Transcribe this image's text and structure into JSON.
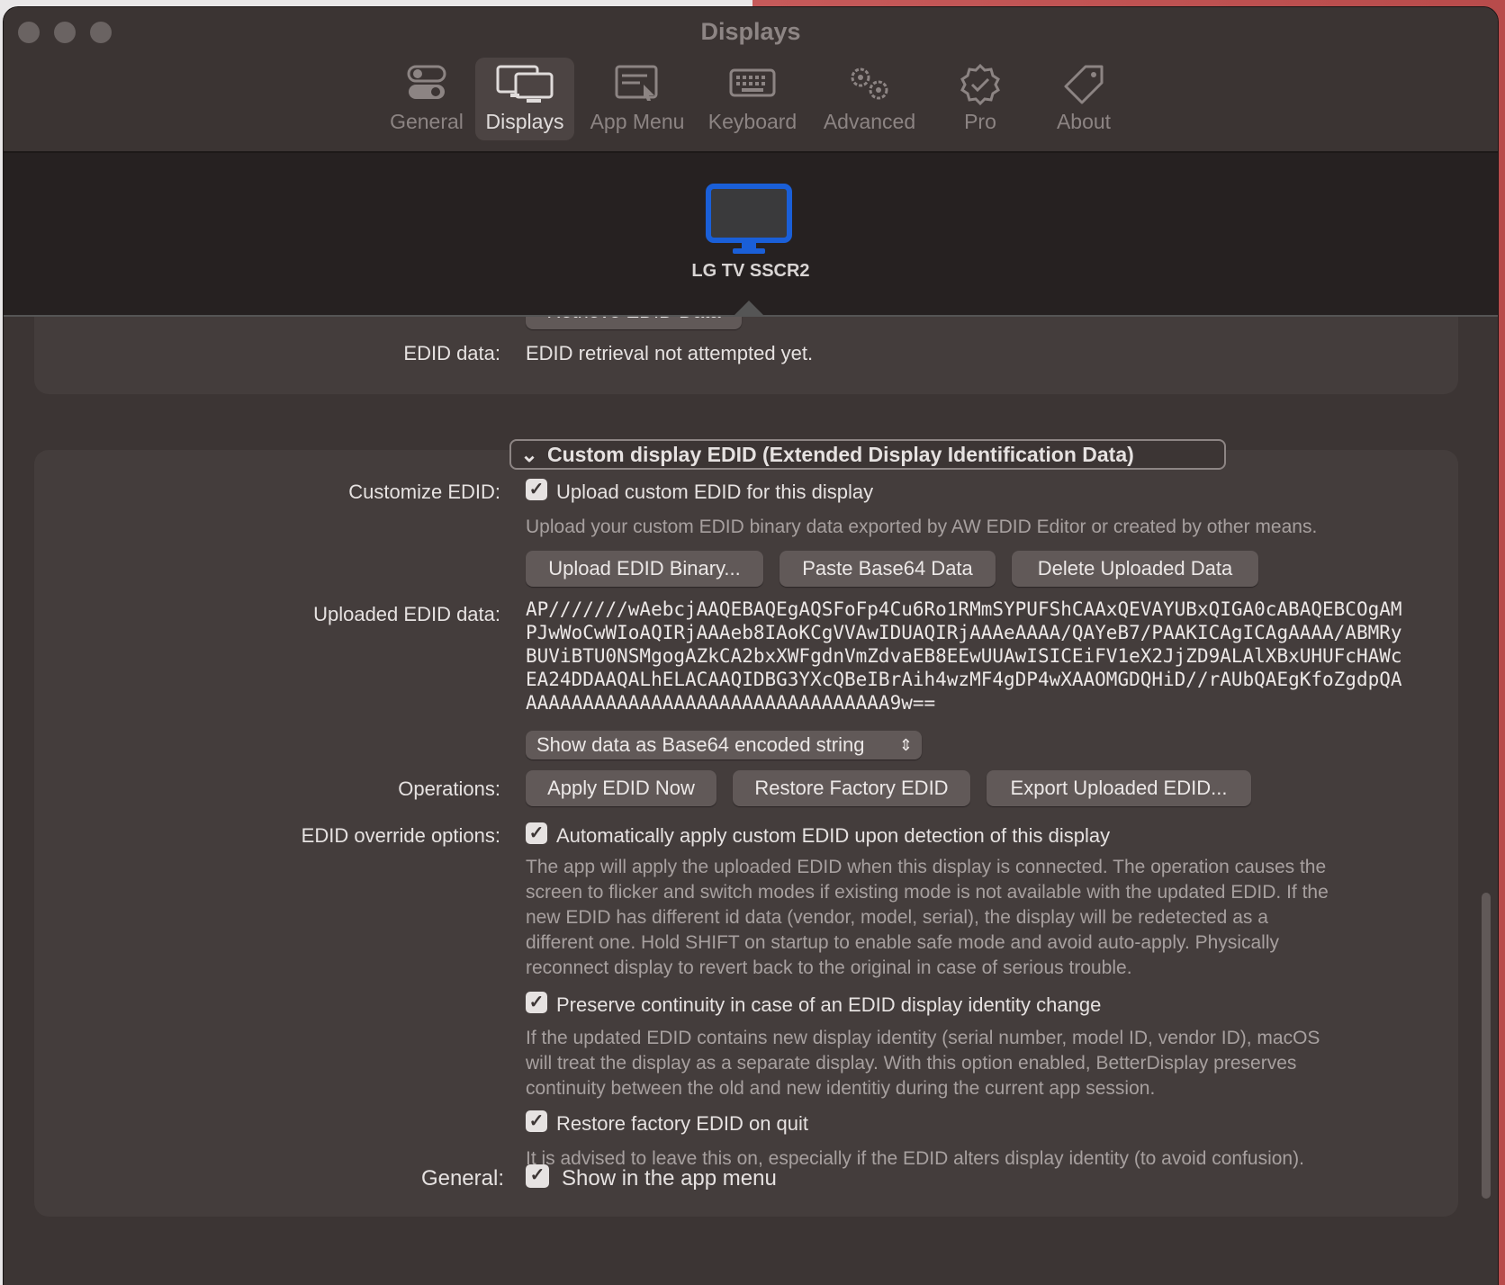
{
  "window": {
    "title": "Displays"
  },
  "toolbar": [
    {
      "label": "General",
      "icon": "toggle-icon"
    },
    {
      "label": "Displays",
      "icon": "displays-icon"
    },
    {
      "label": "App Menu",
      "icon": "app-menu-icon"
    },
    {
      "label": "Keyboard",
      "icon": "keyboard-icon"
    },
    {
      "label": "Advanced",
      "icon": "gears-icon"
    },
    {
      "label": "Pro",
      "icon": "seal-check-icon"
    },
    {
      "label": "About",
      "icon": "tag-icon"
    }
  ],
  "display": {
    "name": "LG TV SSCR2",
    "icon": "monitor-icon",
    "accent": "#1a5fd8"
  },
  "edid_retrieval": {
    "button": "Retrieve EDID Data",
    "label": "EDID data:",
    "value": "EDID retrieval not attempted yet."
  },
  "custom_section": {
    "title": "Custom display EDID (Extended Display Identification Data)",
    "customize_label": "Customize EDID:",
    "customize_checkbox": "Upload custom EDID for this display",
    "customize_desc": "Upload your custom EDID binary data exported by AW EDID Editor or created by other means.",
    "buttons": {
      "upload": "Upload EDID Binary...",
      "paste": "Paste Base64 Data",
      "delete": "Delete Uploaded Data"
    },
    "uploaded_label": "Uploaded EDID data:",
    "uploaded_lines": [
      "AP///////wAebcjAAQEBAQEgAQSFoFp4Cu6Ro1RMmSYPUFShCAAxQEVAYUBxQIGA0cABAQEBCOgAM",
      "PJwWoCwWIoAQIRjAAAeb8IAoKCgVVAwIDUAQIRjAAAeAAAA/QAYeB7/PAAKICAgICAgAAAA/ABMRy",
      "BUViBTU0NSMgogAZkCA2bxXWFgdnVmZdvaEB8EEwUUAwISICEiFV1eX2JjZD9ALAlXBxUHUFcHAWc",
      "EA24DDAAQALhELACAAQIDBG3YXcQBeIBrAih4wzMF4gDP4wXAAOMGDQHiD//rAUbQAEgKfoZgdpQA",
      "AAAAAAAAAAAAAAAAAAAAAAAAAAAAAAAA9w=="
    ],
    "format_select": "Show data as Base64 encoded string",
    "operations_label": "Operations:",
    "operations": {
      "apply": "Apply EDID Now",
      "restore": "Restore Factory EDID",
      "export": "Export Uploaded EDID..."
    },
    "override_label": "EDID override options:",
    "auto_apply": "Automatically apply custom EDID upon detection of this display",
    "auto_apply_desc": [
      "The app will apply the uploaded EDID when this display is connected. The operation causes the",
      "screen to flicker and switch modes if existing mode is not available with the updated EDID. If the",
      "new EDID has different id data (vendor, model, serial), the display will be redetected as a",
      "different one. Hold SHIFT on startup to enable safe mode and avoid auto-apply. Physically",
      "reconnect  display to revert back to the original in case of serious trouble."
    ],
    "preserve": "Preserve continuity in case of an EDID display identity change",
    "preserve_desc": [
      "If the updated EDID contains new display identity (serial number, model ID, vendor ID), macOS",
      "will treat the display as a separate display. With this option enabled, BetterDisplay preserves",
      "continuity between the old and new identitiy during the current app session."
    ],
    "restore_on_quit": "Restore factory EDID on quit",
    "restore_on_quit_desc": "It is advised to leave this on, especially if the EDID alters display identity (to avoid confusion)."
  },
  "general": {
    "label": "General:",
    "checkbox": "Show in the app menu"
  }
}
